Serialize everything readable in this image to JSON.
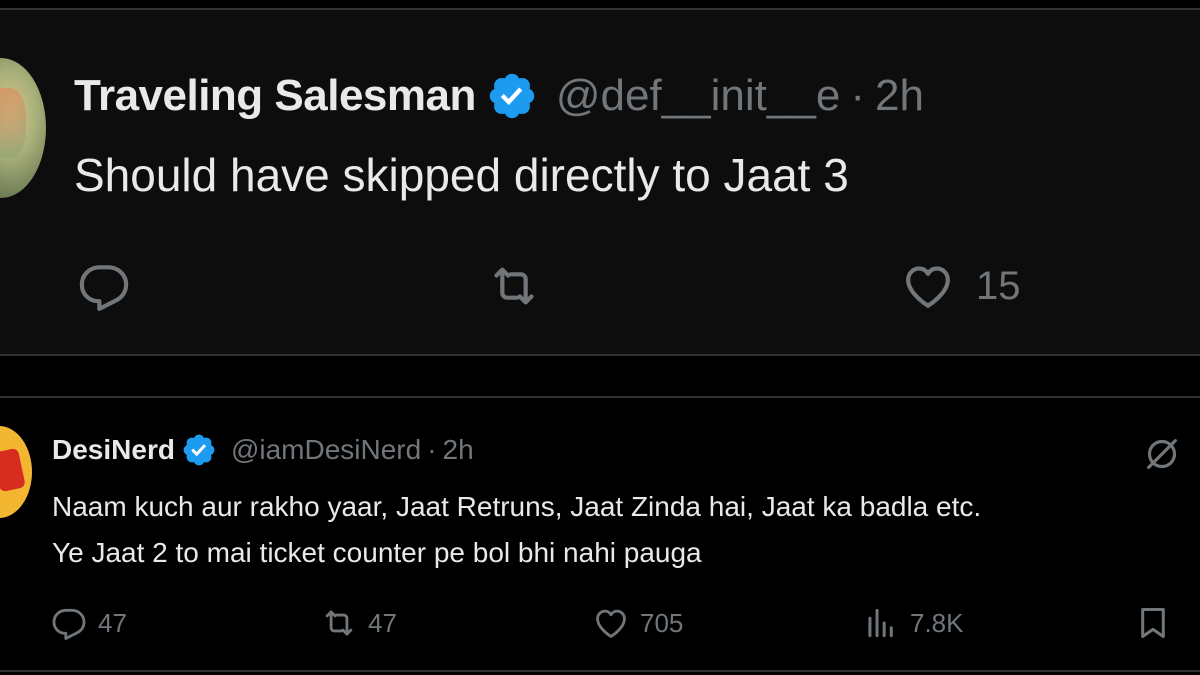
{
  "top_tweet": {
    "author_name": "Traveling Salesman",
    "handle": "@def__init__e",
    "separator": "·",
    "time": "2h",
    "text": "Should have skipped directly to Jaat 3",
    "like_count": "15",
    "icons": [
      "reply-icon",
      "retweet-icon",
      "like-icon",
      "verified-badge-icon"
    ]
  },
  "bottom_tweet": {
    "author_name": "DesiNerd",
    "handle": "@iamDesiNerd",
    "separator": "·",
    "time": "2h",
    "text_line1": "Naam kuch aur rakho yaar, Jaat Retruns, Jaat Zinda hai, Jaat ka badla etc.",
    "text_line2": "Ye Jaat 2 to mai ticket counter pe bol bhi nahi pauga",
    "reply_count": "47",
    "retweet_count": "47",
    "like_count": "705",
    "view_count": "7.8K",
    "icons": [
      "reply-icon",
      "retweet-icon",
      "like-icon",
      "views-icon",
      "bookmark-icon",
      "grok-icon",
      "verified-badge-icon"
    ]
  },
  "colors": {
    "background": "#000000",
    "text_primary": "#e7e9ea",
    "text_secondary": "#71767b",
    "verified_blue": "#1d9bf0",
    "divider": "#2f3336"
  }
}
